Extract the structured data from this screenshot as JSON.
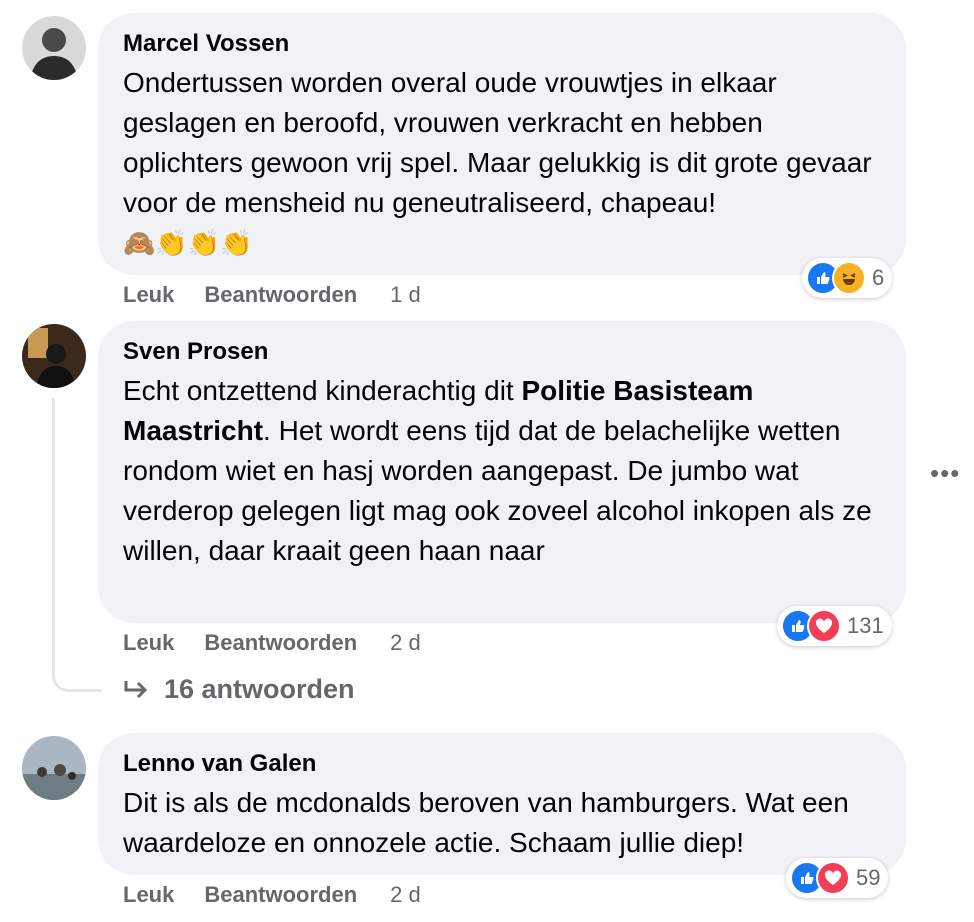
{
  "comments": [
    {
      "author": "Marcel Vossen",
      "text": "Ondertussen worden overal oude vrouwtjes in elkaar geslagen en beroofd, vrouwen verkracht en hebben oplichters gewoon vrij spel. Maar gelukkig is dit grote gevaar voor de mensheid nu geneutraliseerd, chapeau!",
      "emojis": "🙈👏👏👏",
      "reactions": [
        "like-icon",
        "haha-icon"
      ],
      "reaction_count": "6",
      "like_label": "Leuk",
      "reply_label": "Beantwoorden",
      "time": "1 d"
    },
    {
      "author": "Sven Prosen",
      "text_before": "Echt ontzettend kinderachtig dit ",
      "mention": "Politie Basisteam Maastricht",
      "text_after": ". Het wordt eens tijd dat de belachelijke wetten rondom wiet en hasj worden aangepast. De jumbo wat verderop gelegen ligt mag ook zoveel alcohol inkopen als ze willen, daar kraait geen haan naar",
      "reactions": [
        "like-icon",
        "love-icon"
      ],
      "reaction_count": "131",
      "like_label": "Leuk",
      "reply_label": "Beantwoorden",
      "time": "2 d",
      "replies_label": "16 antwoorden"
    },
    {
      "author": "Lenno van Galen",
      "text": "Dit is als de mcdonalds beroven van hamburgers. Wat een waardeloze en onnozele actie. Schaam jullie diep!",
      "reactions": [
        "like-icon",
        "love-icon"
      ],
      "reaction_count": "59",
      "like_label": "Leuk",
      "reply_label": "Beantwoorden",
      "time": "2 d"
    }
  ],
  "more_options": "•••",
  "colors": {
    "like": "#1877f2",
    "love": "#f33e58",
    "haha": "#f7b125",
    "bubble": "#f0f2f5",
    "meta": "#65676b"
  }
}
